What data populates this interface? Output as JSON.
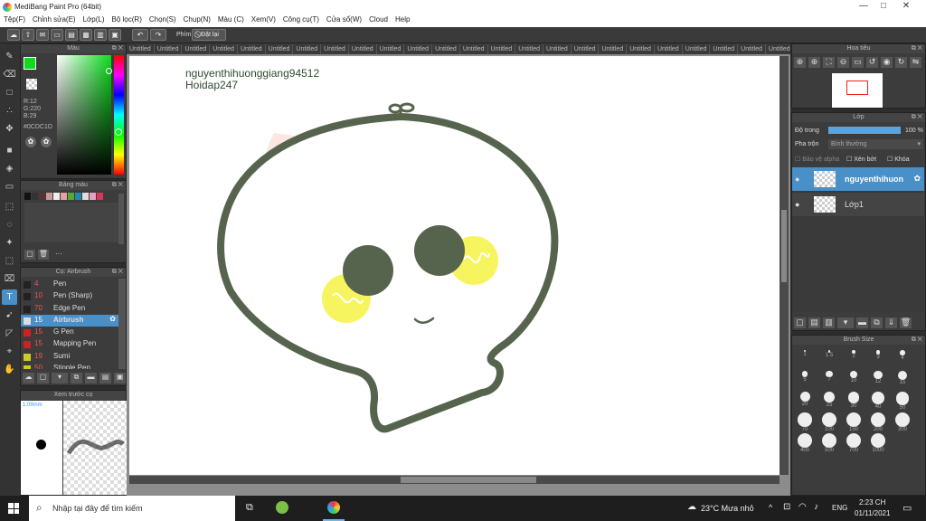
{
  "window": {
    "title": "MediBang Paint Pro (64bit)",
    "minimize": "—",
    "maximize": "□",
    "close": "✕"
  },
  "menu": [
    "Tệp(F)",
    "Chỉnh sửa(E)",
    "Lớp(L)",
    "Bộ lọc(R)",
    "Chọn(S)",
    "Chụp(N)",
    "Màu (C)",
    "Xem(V)",
    "Công cụ(T)",
    "Cửa sổ(W)",
    "Cloud",
    "Help"
  ],
  "toolbar": {
    "phim_label": "Phím",
    "dat_lai_label": "Đặt lại"
  },
  "tabs": [
    "Untitled",
    "Untitled",
    "Untitled",
    "Untitled",
    "Untitled",
    "Untitled",
    "Untitled",
    "Untitled",
    "Untitled",
    "Untitled",
    "Untitled",
    "Untitled",
    "Untitled",
    "Untitled",
    "Untitled",
    "Untitled",
    "Untitled",
    "Untitled",
    "Untitled",
    "Untitled",
    "Untitled",
    "Untitled",
    "Untitled",
    "Untitled",
    "Untitled"
  ],
  "color_panel": {
    "title": "Màu",
    "r": "R:12",
    "g": "G:220",
    "b": "B:29",
    "hex": "#0CDC1D",
    "fg": "#0cdc1d"
  },
  "palette_panel": {
    "title": "Bảng màu",
    "more": "···",
    "swatches": [
      "#111111",
      "#333333",
      "#553333",
      "#cc9999",
      "#eeeeee",
      "#e6a0a0",
      "#55aa33",
      "#2288aa",
      "#dddddd",
      "#e8a0c0",
      "#dd3355"
    ]
  },
  "brush_panel": {
    "title": "Cọ: Airbrush",
    "items": [
      {
        "size": "4",
        "name": "Pen",
        "color": "#222222"
      },
      {
        "size": "10",
        "name": "Pen (Sharp)",
        "color": "#222222"
      },
      {
        "size": "70",
        "name": "Edge Pen",
        "color": "#222222"
      },
      {
        "size": "15",
        "name": "Airbrush",
        "color": "#dddddd",
        "selected": true
      },
      {
        "size": "15",
        "name": "G Pen",
        "color": "#cc2222"
      },
      {
        "size": "15",
        "name": "Mapping Pen",
        "color": "#cc2222"
      },
      {
        "size": "19",
        "name": "Sumi",
        "color": "#cccc22"
      },
      {
        "size": "50",
        "name": "Stipple Pen",
        "color": "#cccc22"
      }
    ]
  },
  "preview_panel": {
    "title": "Xem trước cọ",
    "size": "1.09mm"
  },
  "canvas": {
    "line1": "nguyenthihuonggiang94512",
    "line2": "Hoidap247"
  },
  "navigator": {
    "title": "Hoa tiêu"
  },
  "layer_panel": {
    "title": "Lớp",
    "opacity_label": "Độ trong",
    "opacity_value": "100 %",
    "blend_label": "Pha trộn",
    "blend_value": "Bình thường",
    "protect_alpha": "Bảo vệ alpha",
    "clip": "Xén bớt",
    "lock": "Khóa",
    "layers": [
      {
        "name": "nguyenthihuon",
        "selected": true
      },
      {
        "name": "Lớp1",
        "selected": false
      }
    ]
  },
  "brush_size": {
    "title": "Brush Size",
    "values": [
      "1",
      "1.5",
      "2",
      "3",
      "4",
      "5",
      "7",
      "10",
      "12",
      "15",
      "20",
      "25",
      "30",
      "40",
      "50",
      "70",
      "100",
      "150",
      "200",
      "300",
      "400",
      "500",
      "700",
      "1000"
    ]
  },
  "taskbar": {
    "search": "Nhập tại đây để tìm kiếm",
    "weather": "23°C Mưa nhỏ",
    "lang": "ENG",
    "time": "2:23 CH",
    "date": "01/11/2021"
  }
}
